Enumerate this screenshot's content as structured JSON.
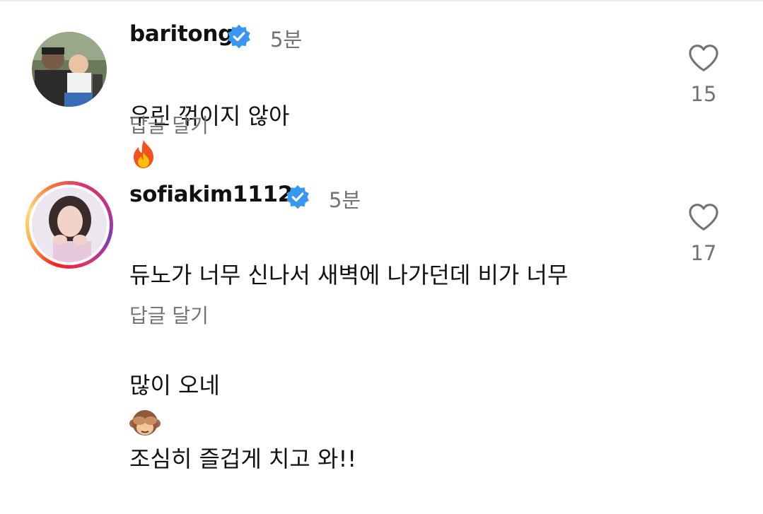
{
  "comments": [
    {
      "username": "baritong",
      "time": "5분",
      "text": "우린 꺾이지 않아",
      "emoji": "fire",
      "reply_label": "답글 달기",
      "likes": "15",
      "has_story": false
    },
    {
      "username": "sofiakim1112",
      "time": "5분",
      "text_line1": "듀노가 너무 신나서 새벽에 나가던데 비가 너무",
      "text_line2_before": "많이 오네",
      "emoji": "see-no-evil-monkey",
      "text_line2_after": " 조심히 즐겁게 치고 와!!",
      "reply_label": "답글 달기",
      "likes": "17",
      "has_story": true
    }
  ],
  "colors": {
    "verified": "#3897f0",
    "secondary_text": "#737373",
    "heart_outline": "#737373"
  }
}
